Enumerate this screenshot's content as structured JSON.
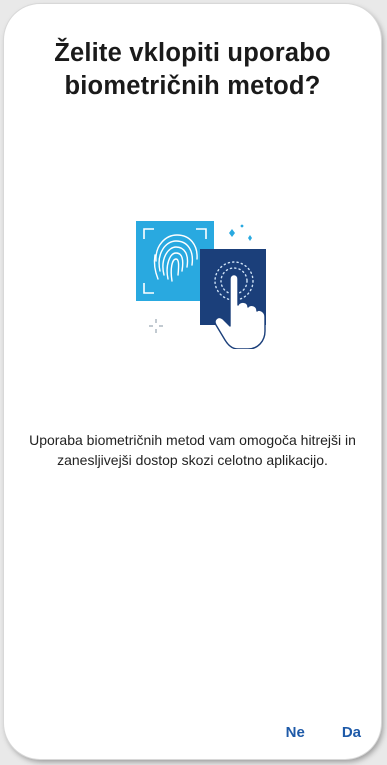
{
  "dialog": {
    "title_line1": "Želite vklopiti uporabo",
    "title_line2": "biometričnih metod?",
    "description": "Uporaba biometričnih metod vam omogoča hitrejši in zanesljivejši dostop skozi celotno aplikacijo.",
    "illustration": "fingerprint-tap-icon"
  },
  "actions": {
    "no_label": "Ne",
    "yes_label": "Da"
  },
  "colors": {
    "accent": "#1e5aa8",
    "light_blue": "#29a9e0",
    "dark_blue": "#1b3f7a"
  }
}
